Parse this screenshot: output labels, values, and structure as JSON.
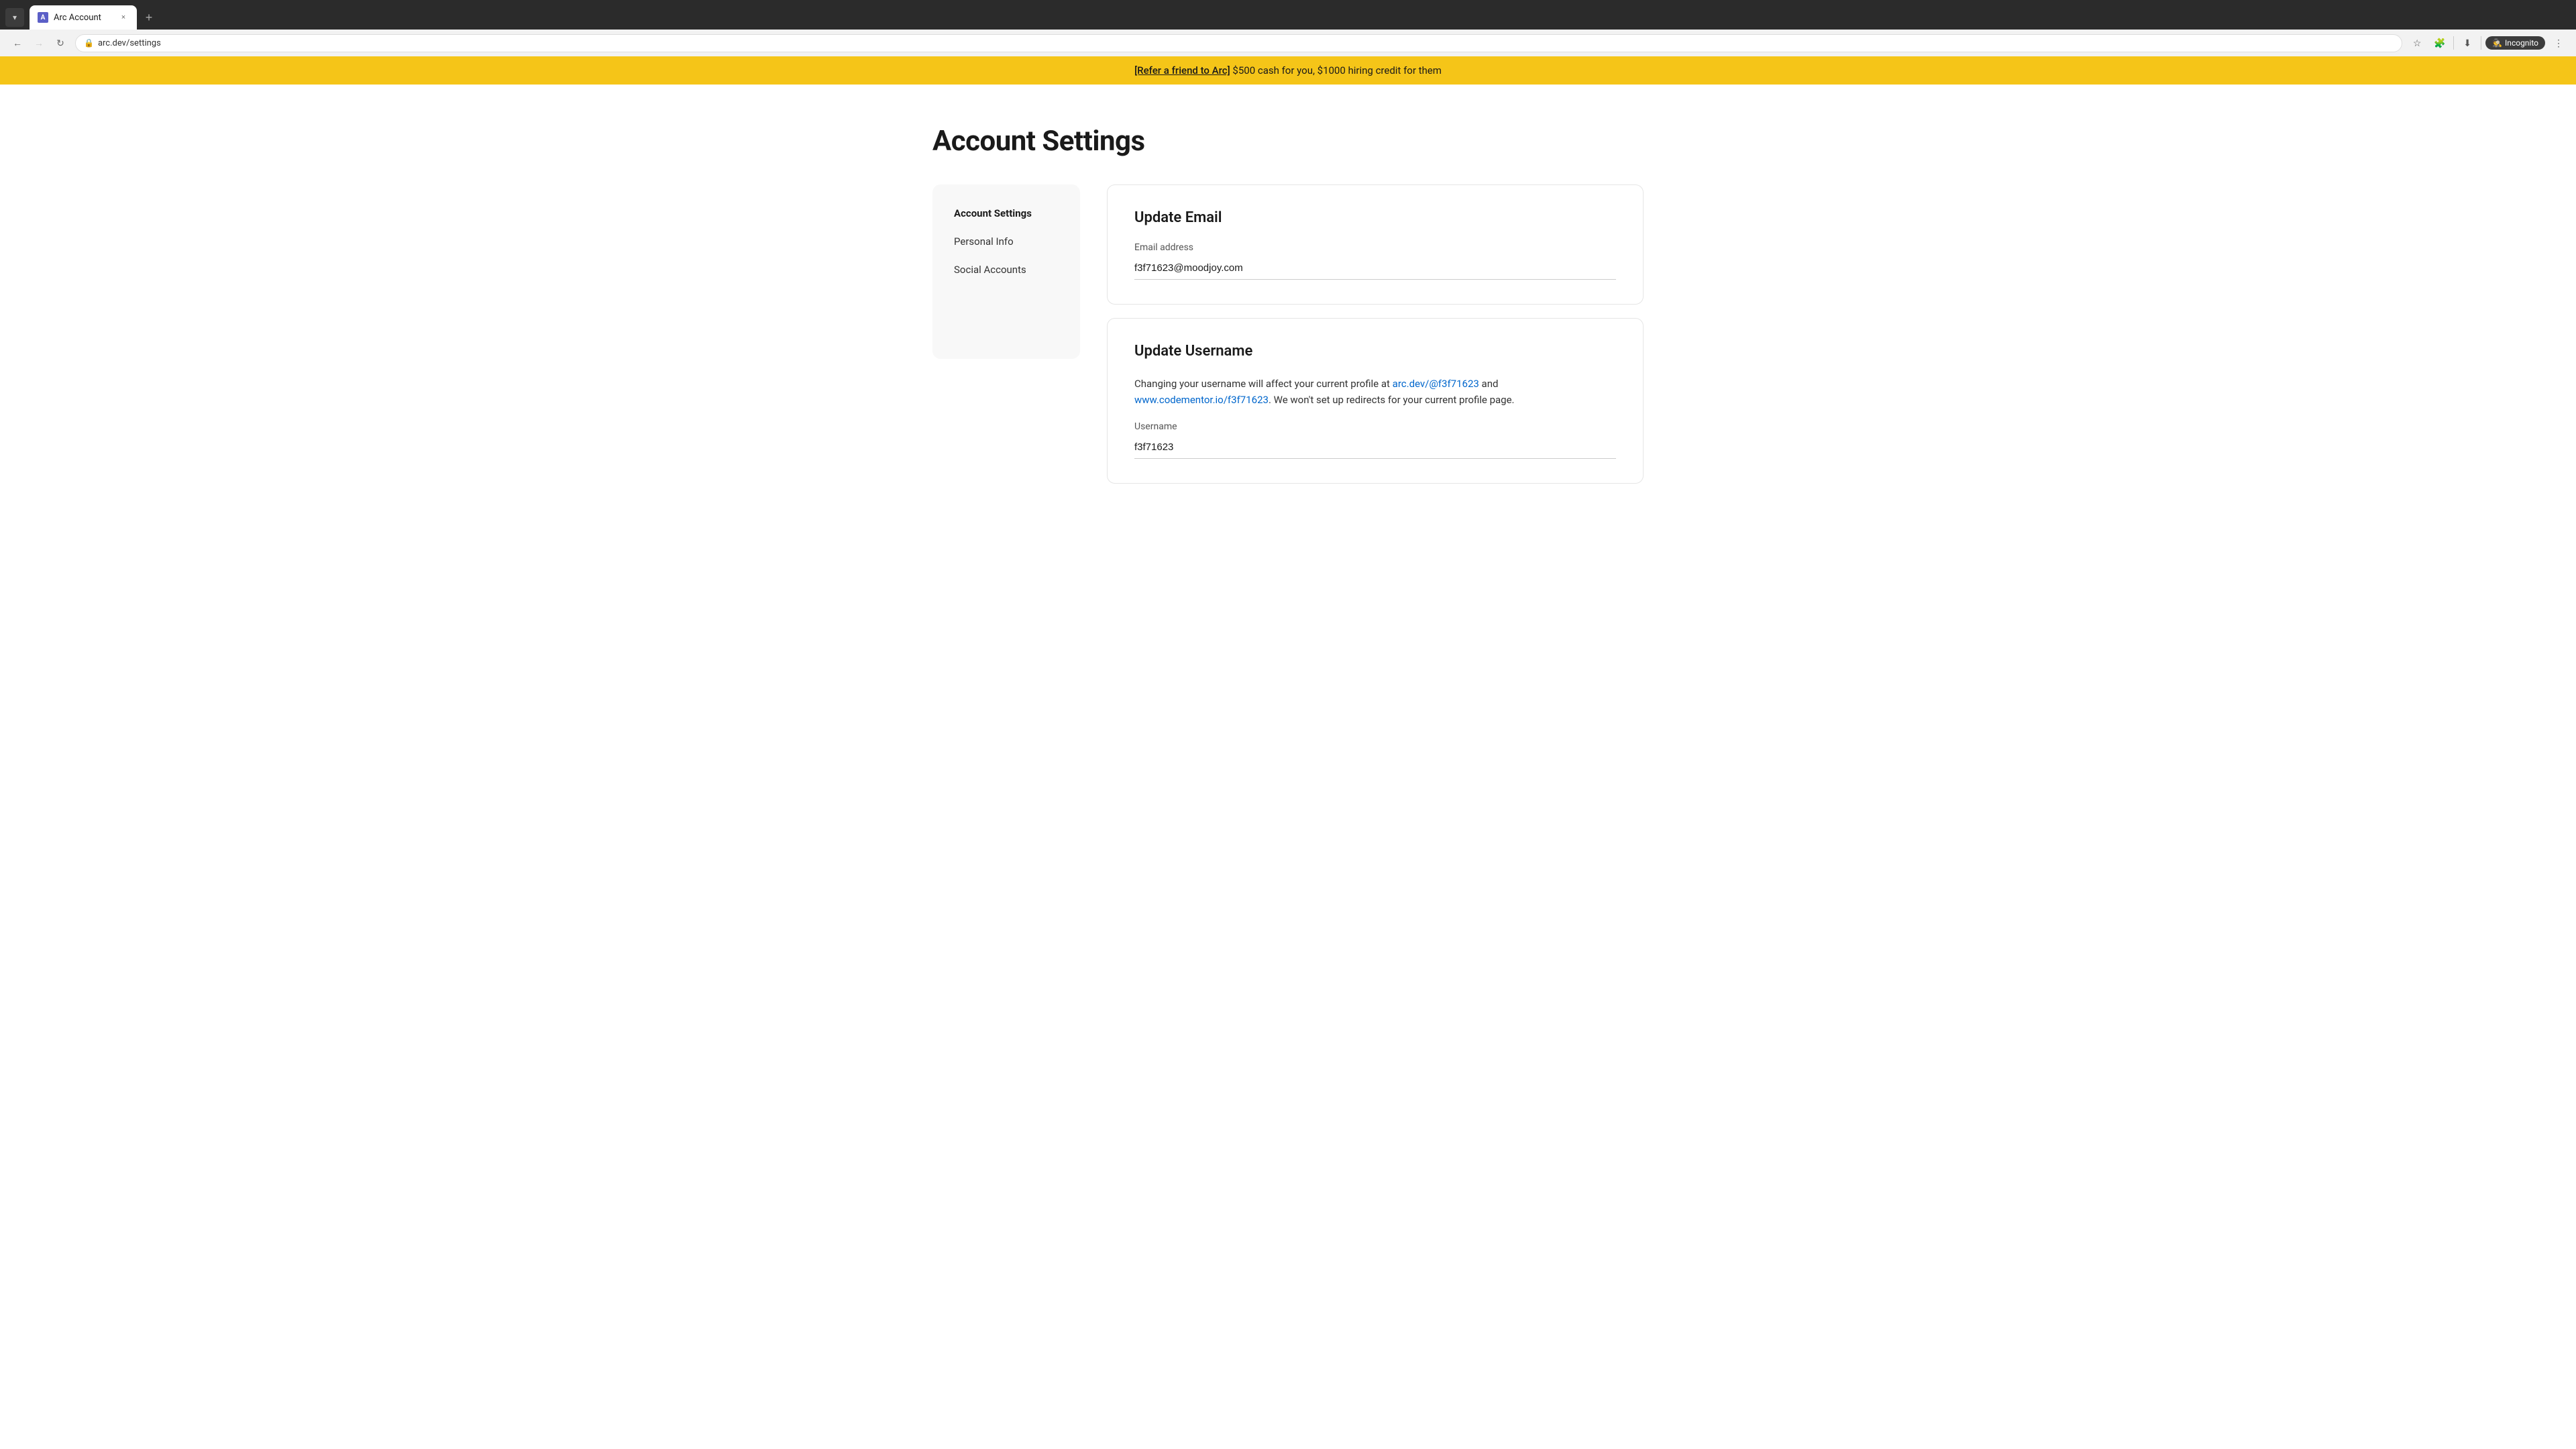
{
  "browser": {
    "tab": {
      "favicon_text": "A",
      "title": "Arc Account",
      "close_label": "×"
    },
    "new_tab_label": "+",
    "address_bar": {
      "url": "arc.dev/settings",
      "security_icon": "🔒"
    },
    "actions": {
      "bookmark_icon": "☆",
      "extensions_icon": "🧩",
      "download_icon": "⬇",
      "incognito_label": "Incognito",
      "more_icon": "⋮"
    },
    "nav": {
      "back_icon": "←",
      "forward_icon": "→",
      "reload_icon": "↻"
    },
    "window_title": "Arc Account"
  },
  "banner": {
    "link_text": "[Refer a friend to Arc]",
    "text": " $500 cash for you, $1000 hiring credit for them"
  },
  "page": {
    "title": "Account Settings",
    "sidebar": {
      "items": [
        {
          "label": "Account Settings",
          "active": true
        },
        {
          "label": "Personal Info",
          "active": false
        },
        {
          "label": "Social Accounts",
          "active": false
        }
      ]
    },
    "update_email": {
      "title": "Update Email",
      "label": "Email address",
      "value": "f3f71623@moodjoy.com"
    },
    "update_username": {
      "title": "Update Username",
      "description_before": "Changing your username will affect your current profile at ",
      "arc_link": "arc.dev/@f3f71623",
      "description_middle": " and ",
      "codementor_link": "www.codementor.io/f3f71623",
      "description_after": ". We won't set up redirects for your current profile page.",
      "label": "Username",
      "value": "f3f71623"
    }
  }
}
